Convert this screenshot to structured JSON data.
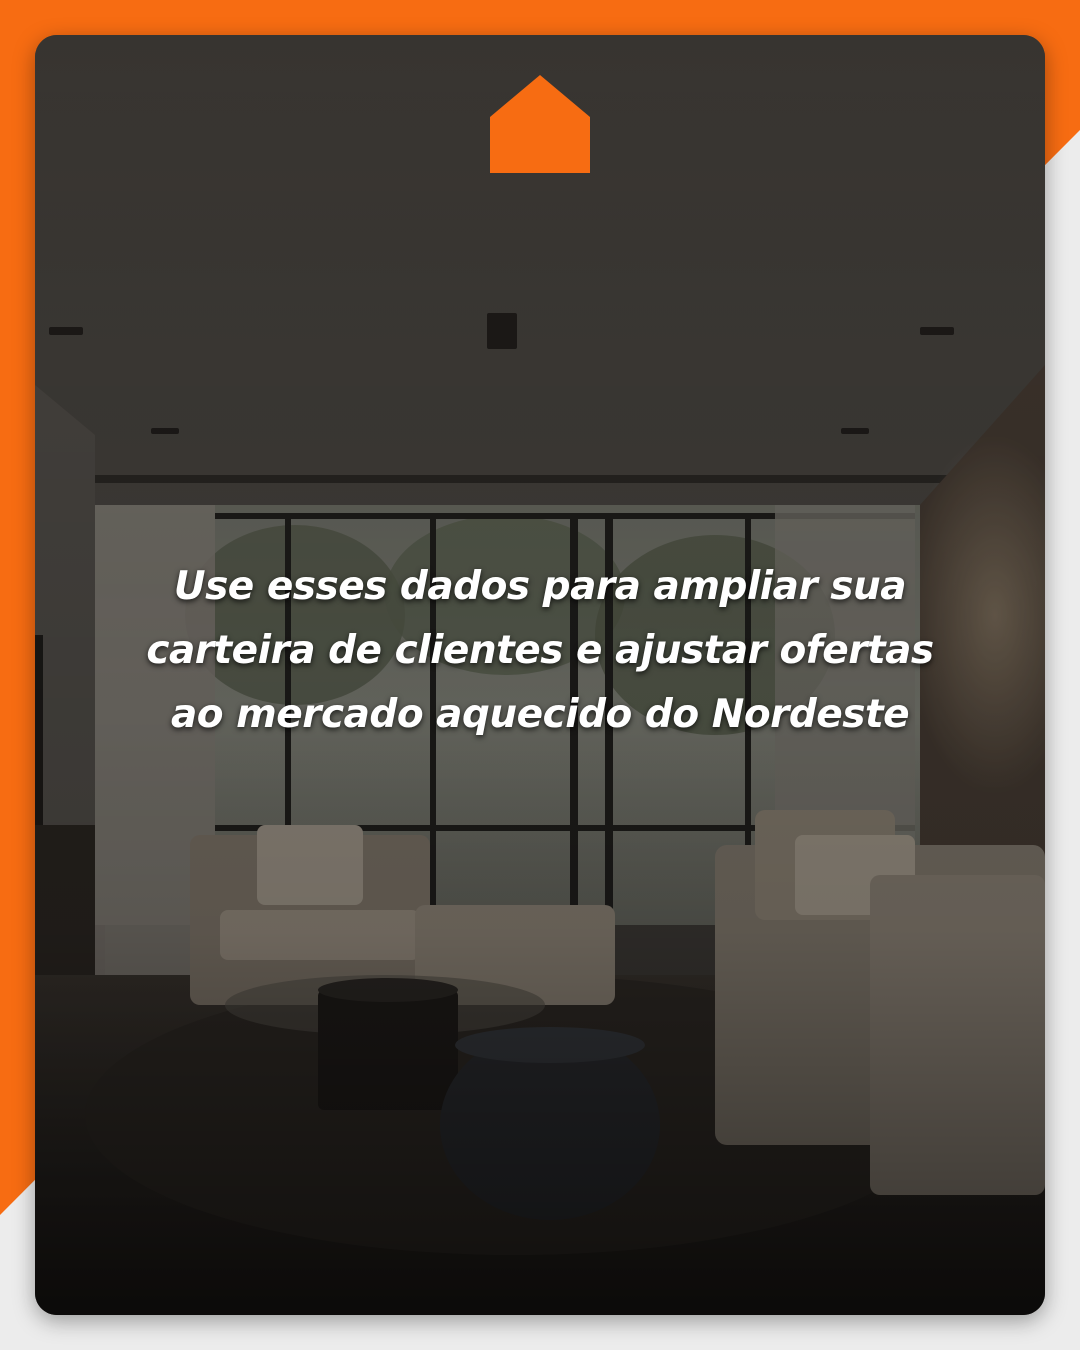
{
  "brand": {
    "logo_icon": "house-icon",
    "accent_color": "#f76c12"
  },
  "background_image": {
    "description_icon": "living-room-photo"
  },
  "caption": {
    "text": "Use esses dados para ampliar sua carteira de clientes e ajustar ofertas ao mercado aquecido do Nordeste"
  }
}
